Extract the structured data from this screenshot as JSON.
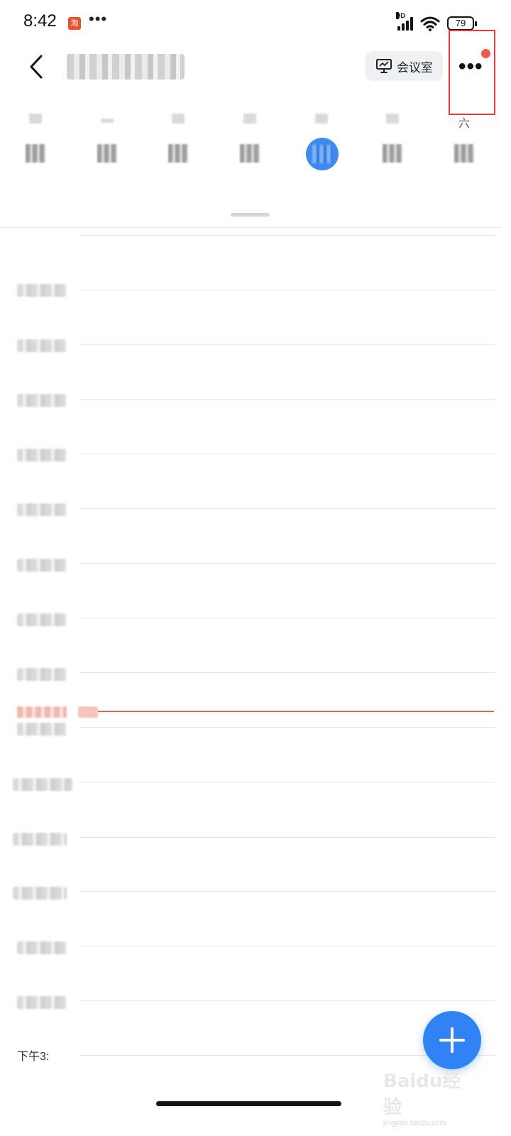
{
  "status_bar": {
    "time": "8:42",
    "app_badge": "淘",
    "more": "•••",
    "network": "HD",
    "battery": "79"
  },
  "header": {
    "meeting_room_label": "会议室",
    "more_label": "•••",
    "weekday_visible": "六"
  },
  "timeline": {
    "last_label": "下午3:"
  },
  "watermark": {
    "brand": "Baidu经验",
    "url": "jingyan.baidu.com"
  },
  "colors": {
    "accent": "#2f83f5",
    "today_circle": "#3d8bf0",
    "now_line": "#e0624f",
    "highlight_box": "#e53935",
    "notify_dot": "#e85c4a"
  },
  "icons": [
    "back-icon",
    "presentation-icon",
    "more-icon",
    "plus-icon",
    "wifi-icon",
    "signal-icon",
    "battery-icon"
  ]
}
